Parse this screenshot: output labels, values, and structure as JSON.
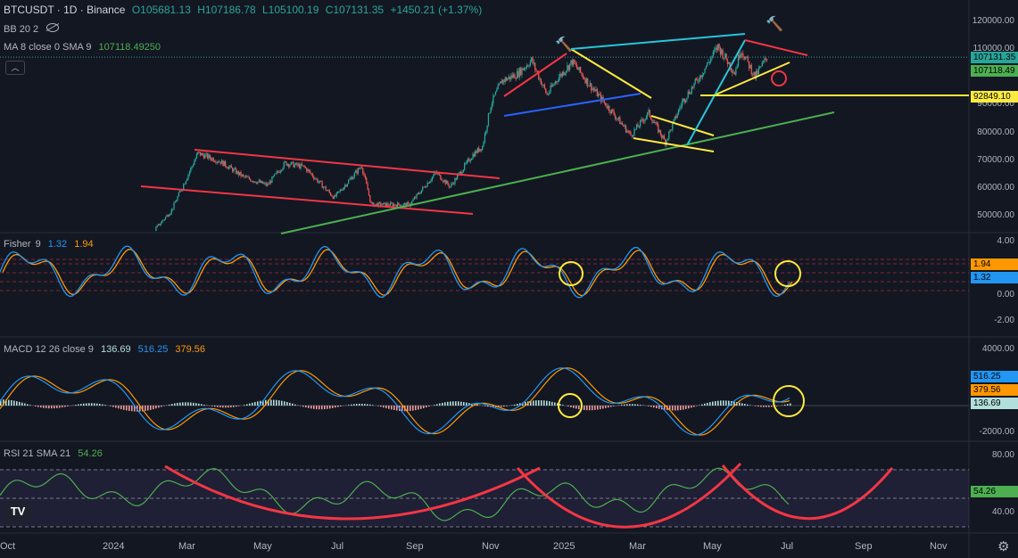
{
  "header": {
    "symbol": "BTCUSDT · 1D · Binance",
    "open": "O105681.13",
    "high": "H107186.78",
    "low": "L105100.19",
    "close": "C107131.35",
    "change": "+1450.21 (+1.37%)",
    "bb": "BB 20 2",
    "ma_label": "MA 8 close 0 SMA 9",
    "ma_value": "107118.49250"
  },
  "colors": {
    "background": "#131722",
    "up": "#26a69a",
    "down": "#ef5350",
    "trendline_red": "#f23645",
    "trendline_yellow": "#ffeb3b",
    "trendline_cyan": "#26c6da",
    "trendline_blue": "#2962ff",
    "trendline_green": "#4caf50",
    "fisher_blue": "#2196f3",
    "fisher_orange": "#ff9800",
    "rsi_line": "#4caf50",
    "rsi_arc": "#f23645"
  },
  "price_axis": {
    "ticks": [
      "120000.00",
      "110000.00",
      "100000.00",
      "90000.00",
      "80000.00",
      "70000.00",
      "60000.00",
      "50000.00"
    ],
    "tags": {
      "close": "107131.35",
      "ma": "107118.49",
      "support": "92849.10"
    }
  },
  "fisher": {
    "label": "Fisher",
    "length": "9",
    "value1": "1.32",
    "value2": "1.94",
    "ticks": [
      "4.00",
      "2.00",
      "0.00",
      "-2.00"
    ]
  },
  "macd": {
    "label": "MACD 12 26 close 9",
    "hist": "136.69",
    "macd": "516.25",
    "signal": "379.56",
    "ticks": [
      "4000.00",
      "2000.00",
      "-2000.00"
    ]
  },
  "rsi": {
    "label": "RSI 21 SMA 21",
    "value": "54.26",
    "ticks": [
      "80.00",
      "60.00",
      "40.00"
    ]
  },
  "time_axis": [
    "Oct",
    "2024",
    "Mar",
    "May",
    "Jul",
    "Sep",
    "Nov",
    "2025",
    "Mar",
    "May",
    "Jul",
    "Sep",
    "Nov"
  ],
  "logo": "TV",
  "icons": [
    "eye-off-icon",
    "collapse-icon",
    "hammer-icon",
    "gear-icon"
  ],
  "chart_data": [
    {
      "type": "candlestick",
      "title": "BTCUSDT · 1D · Binance",
      "ylim": [
        42000,
        126000
      ],
      "xlim": [
        "2023-10-01",
        "2025-11-30"
      ],
      "close_series": [
        {
          "x": "2023-11-01",
          "y": 35000
        },
        {
          "x": "2024-01-01",
          "y": 43000
        },
        {
          "x": "2024-02-01",
          "y": 42500
        },
        {
          "x": "2024-02-20",
          "y": 52000
        },
        {
          "x": "2024-03-13",
          "y": 72500
        },
        {
          "x": "2024-04-01",
          "y": 69500
        },
        {
          "x": "2024-04-20",
          "y": 64000
        },
        {
          "x": "2024-05-10",
          "y": 61000
        },
        {
          "x": "2024-05-25",
          "y": 69000
        },
        {
          "x": "2024-06-10",
          "y": 67500
        },
        {
          "x": "2024-07-05",
          "y": 56500
        },
        {
          "x": "2024-07-28",
          "y": 68000
        },
        {
          "x": "2024-08-05",
          "y": 54000
        },
        {
          "x": "2024-09-06",
          "y": 54000
        },
        {
          "x": "2024-09-28",
          "y": 65500
        },
        {
          "x": "2024-10-10",
          "y": 60500
        },
        {
          "x": "2024-10-29",
          "y": 72000
        },
        {
          "x": "2024-11-06",
          "y": 75000
        },
        {
          "x": "2024-11-13",
          "y": 90000
        },
        {
          "x": "2024-11-22",
          "y": 98500
        },
        {
          "x": "2024-12-05",
          "y": 101000
        },
        {
          "x": "2024-12-17",
          "y": 106000
        },
        {
          "x": "2024-12-30",
          "y": 93500
        },
        {
          "x": "2025-01-07",
          "y": 99000
        },
        {
          "x": "2025-01-20",
          "y": 105500
        },
        {
          "x": "2025-02-03",
          "y": 97500
        },
        {
          "x": "2025-02-25",
          "y": 86000
        },
        {
          "x": "2025-03-10",
          "y": 79000
        },
        {
          "x": "2025-03-25",
          "y": 87000
        },
        {
          "x": "2025-04-08",
          "y": 76500
        },
        {
          "x": "2025-04-22",
          "y": 91000
        },
        {
          "x": "2025-05-08",
          "y": 101000
        },
        {
          "x": "2025-05-22",
          "y": 111000
        },
        {
          "x": "2025-06-05",
          "y": 101500
        },
        {
          "x": "2025-06-10",
          "y": 110000
        },
        {
          "x": "2025-06-22",
          "y": 100000
        },
        {
          "x": "2025-07-02",
          "y": 107131
        }
      ],
      "horizontal_line": {
        "price": 92849.1
      }
    },
    {
      "type": "line",
      "title": "Fisher 9",
      "ylim": [
        -2.8,
        4.2
      ],
      "series": [
        {
          "name": "1.32",
          "last": 1.32
        },
        {
          "name": "1.94",
          "last": 1.94
        }
      ]
    },
    {
      "type": "bar",
      "title": "MACD 12 26 close 9",
      "ylim": [
        -2400,
        4000
      ],
      "series": [
        {
          "name": "136.69",
          "last": 136.69
        },
        {
          "name": "516.25",
          "last": 516.25
        },
        {
          "name": "379.56",
          "last": 379.56
        }
      ]
    },
    {
      "type": "line",
      "title": "RSI 21 SMA 21",
      "ylim": [
        28,
        86
      ],
      "bands": [
        30,
        50,
        70
      ],
      "series": [
        {
          "name": "54.26",
          "last": 54.26
        }
      ],
      "projected_arc": true
    }
  ]
}
